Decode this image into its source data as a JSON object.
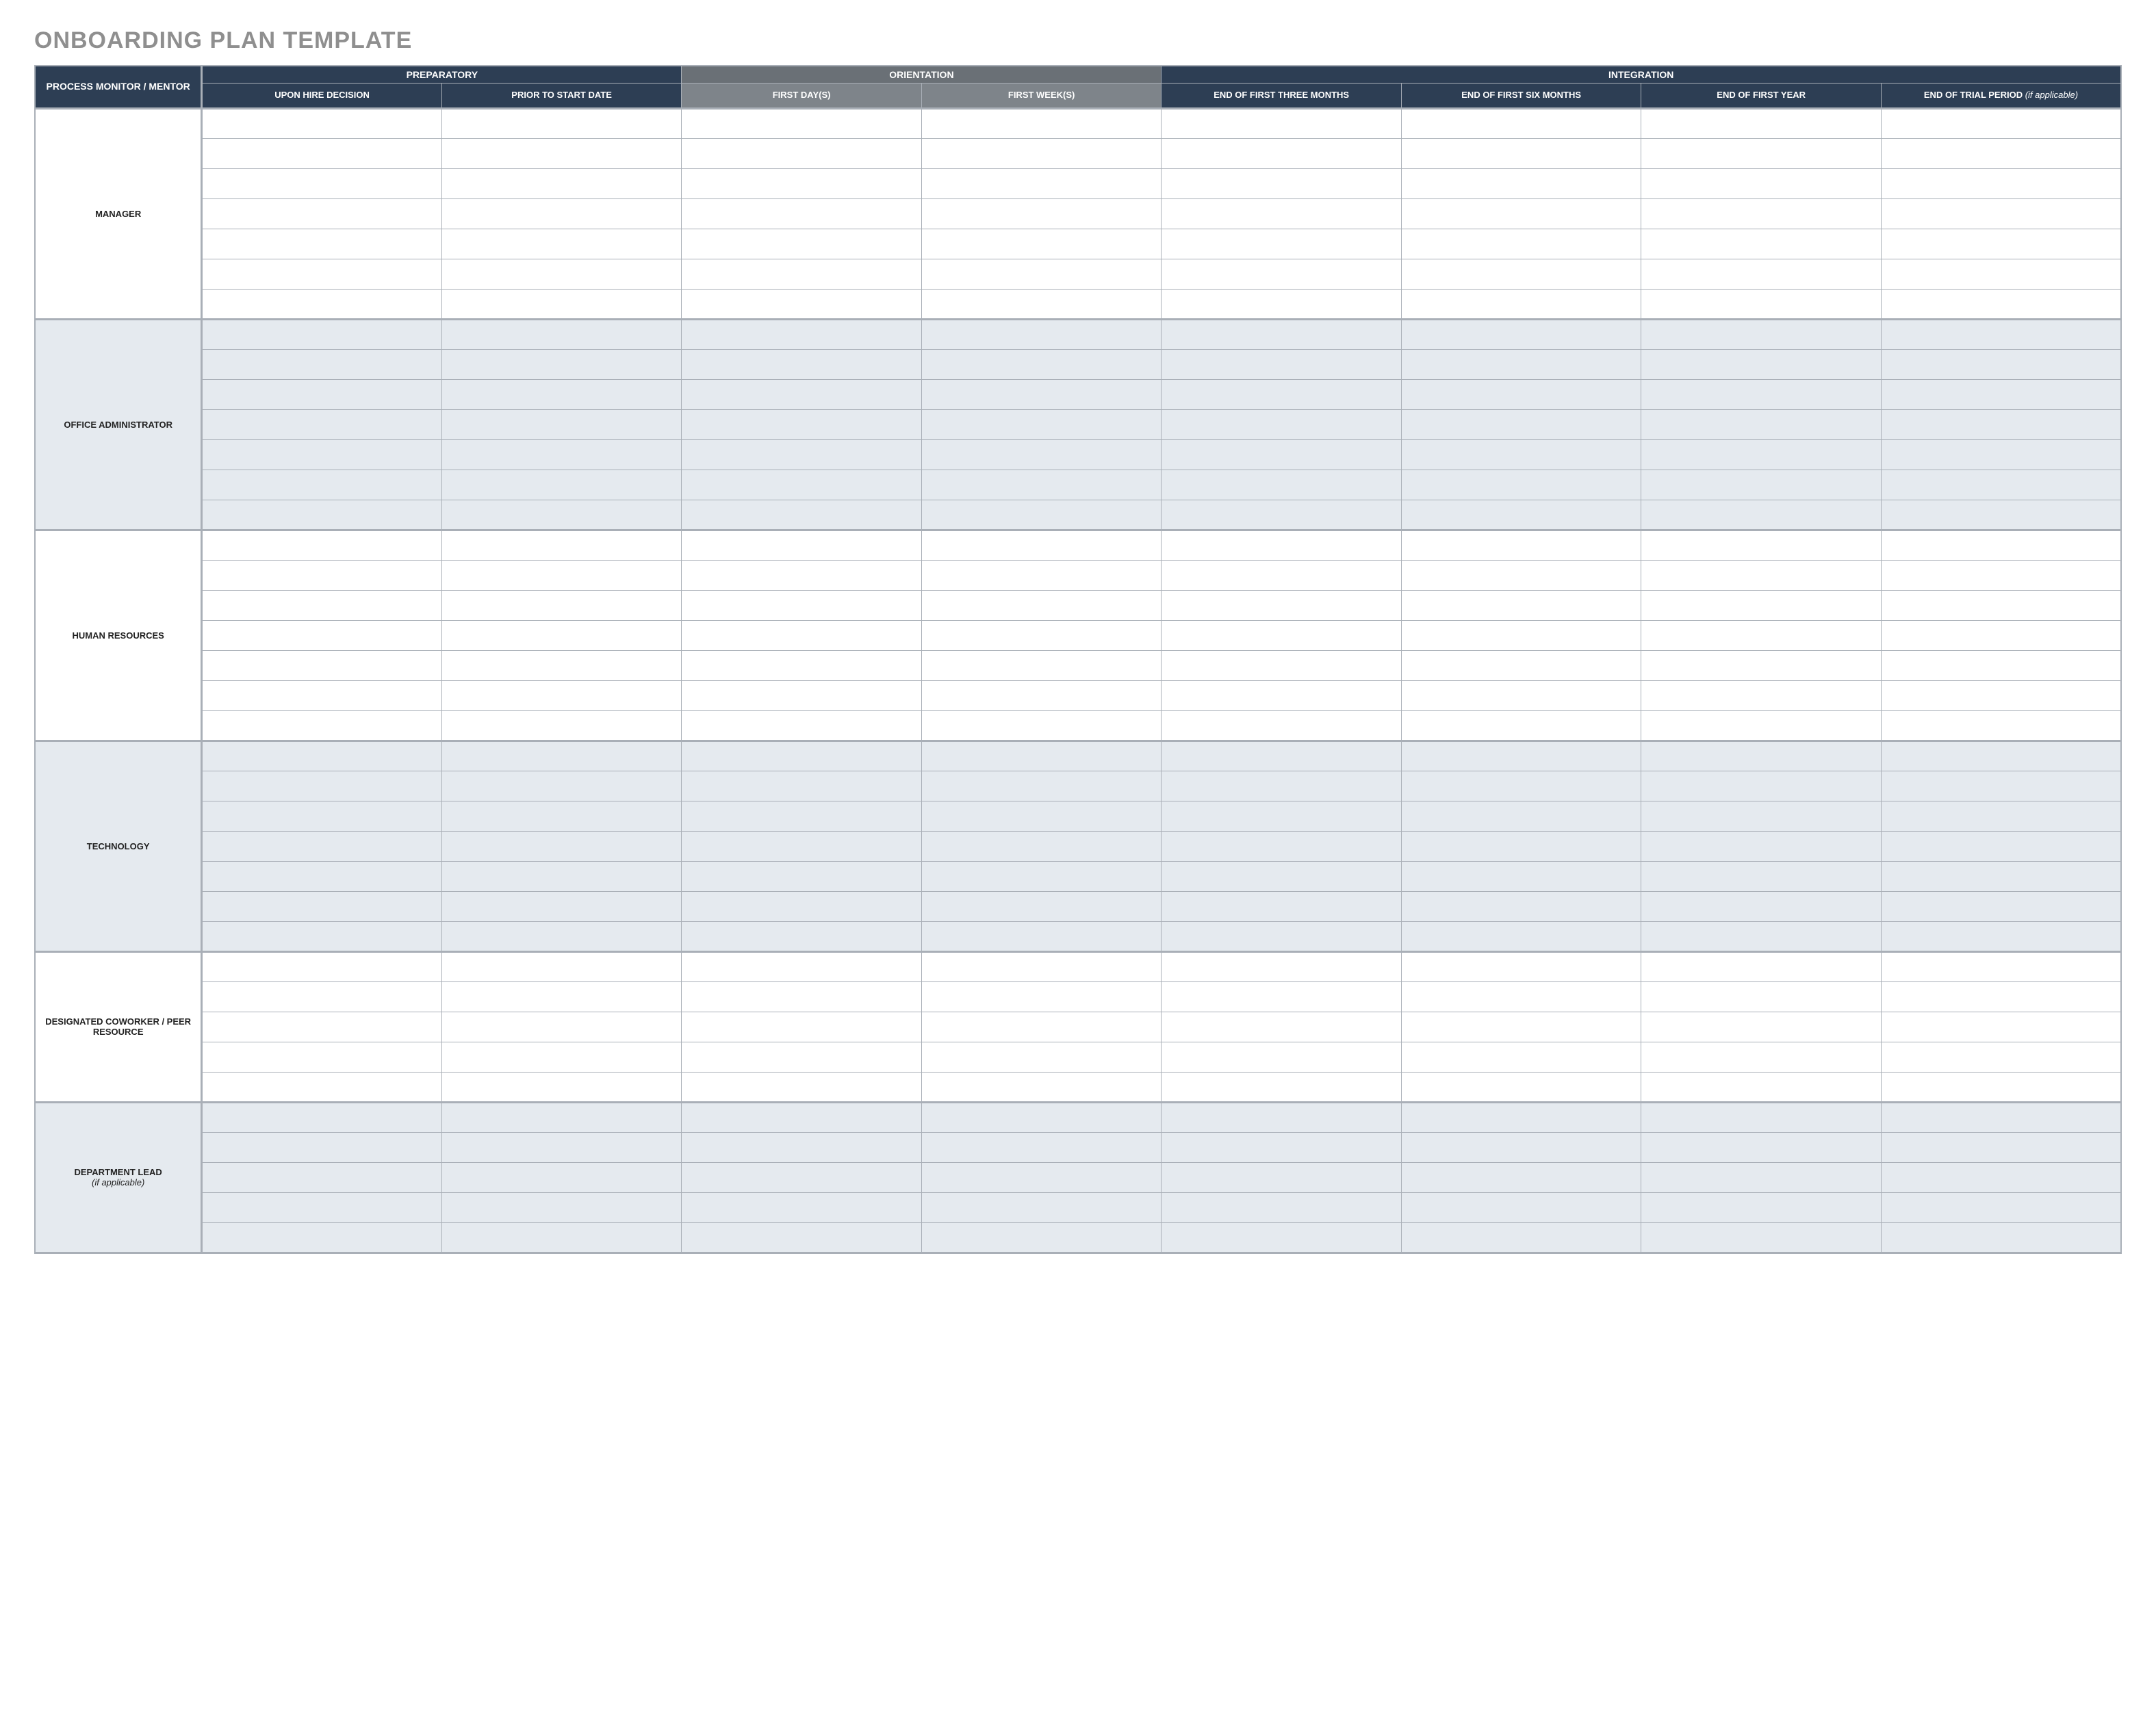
{
  "title": "ONBOARDING PLAN TEMPLATE",
  "cornerHeader": "PROCESS MONITOR / MENTOR",
  "groups": [
    {
      "label": "PREPARATORY",
      "class": "grp-prep",
      "colClass": "col-prep",
      "columns": [
        "UPON HIRE DECISION",
        "PRIOR TO START DATE"
      ]
    },
    {
      "label": "ORIENTATION",
      "class": "grp-orient",
      "colClass": "col-orient",
      "columns": [
        "FIRST DAY(S)",
        "FIRST WEEK(S)"
      ]
    },
    {
      "label": "INTEGRATION",
      "class": "grp-integ",
      "colClass": "col-integ",
      "columns": [
        "END OF FIRST THREE MONTHS",
        "END OF FIRST SIX MONTHS",
        "END OF FIRST YEAR"
      ],
      "lastColumn": {
        "main": "END OF TRIAL PERIOD",
        "note": "(if applicable)"
      }
    }
  ],
  "sections": [
    {
      "label": "MANAGER",
      "sub": "",
      "shade": "white",
      "rows": 7
    },
    {
      "label": "OFFICE ADMINISTRATOR",
      "sub": "",
      "shade": "grey",
      "rows": 7
    },
    {
      "label": "HUMAN RESOURCES",
      "sub": "",
      "shade": "white",
      "rows": 7
    },
    {
      "label": "TECHNOLOGY",
      "sub": "",
      "shade": "grey",
      "rows": 7
    },
    {
      "label": "DESIGNATED COWORKER / PEER RESOURCE",
      "sub": "",
      "shade": "white",
      "rows": 5
    },
    {
      "label": "DEPARTMENT LEAD",
      "sub": "(if applicable)",
      "shade": "grey",
      "rows": 5
    }
  ],
  "totalDataCols": 8
}
